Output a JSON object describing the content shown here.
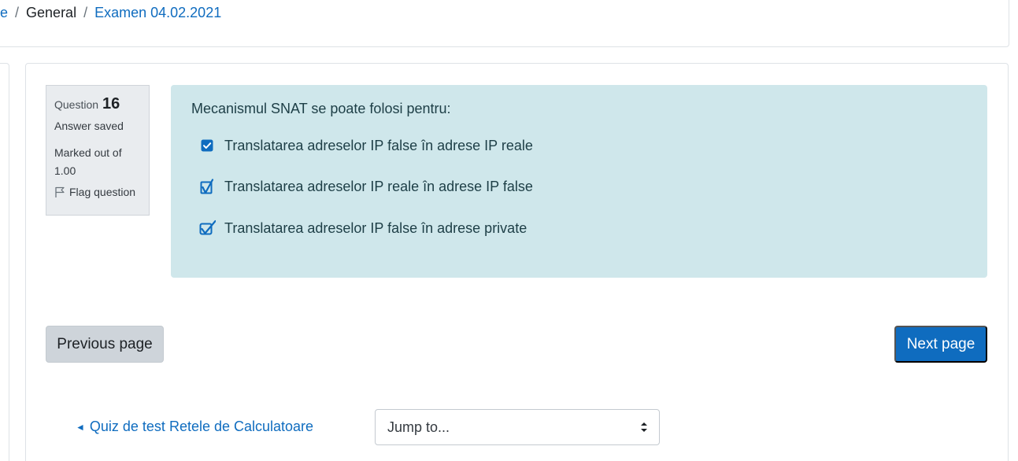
{
  "breadcrumb": {
    "items": [
      "e",
      "General",
      "Examen 04.02.2021"
    ],
    "separator": "/"
  },
  "question_info": {
    "label": "Question",
    "number": "16",
    "state": "Answer saved",
    "grade_line1": "Marked out of",
    "grade_line2": "1.00",
    "flag_label": "Flag question",
    "flag_icon": "flag-icon"
  },
  "question": {
    "text": "Mecanismul SNAT se poate folosi pentru:",
    "options": [
      {
        "label": "Translatarea adreselor IP false în adrese IP reale",
        "checked": true,
        "style": "checkbox"
      },
      {
        "label": "Translatarea adreselor IP reale în adrese IP false",
        "checked": true,
        "style": "hand-drawn"
      },
      {
        "label": "Translatarea adreselor IP false în adrese private",
        "checked": true,
        "style": "hand-drawn"
      }
    ]
  },
  "navigation": {
    "previous_label": "Previous page",
    "next_label": "Next page",
    "back_link_arrow": "◄",
    "back_link_label": "Quiz de test Retele de Calculatoare",
    "jump_placeholder": "Jump to..."
  },
  "colors": {
    "accent": "#0f6cbf",
    "formulation_bg": "#cfe7eb",
    "info_bg": "#e9ecef"
  }
}
